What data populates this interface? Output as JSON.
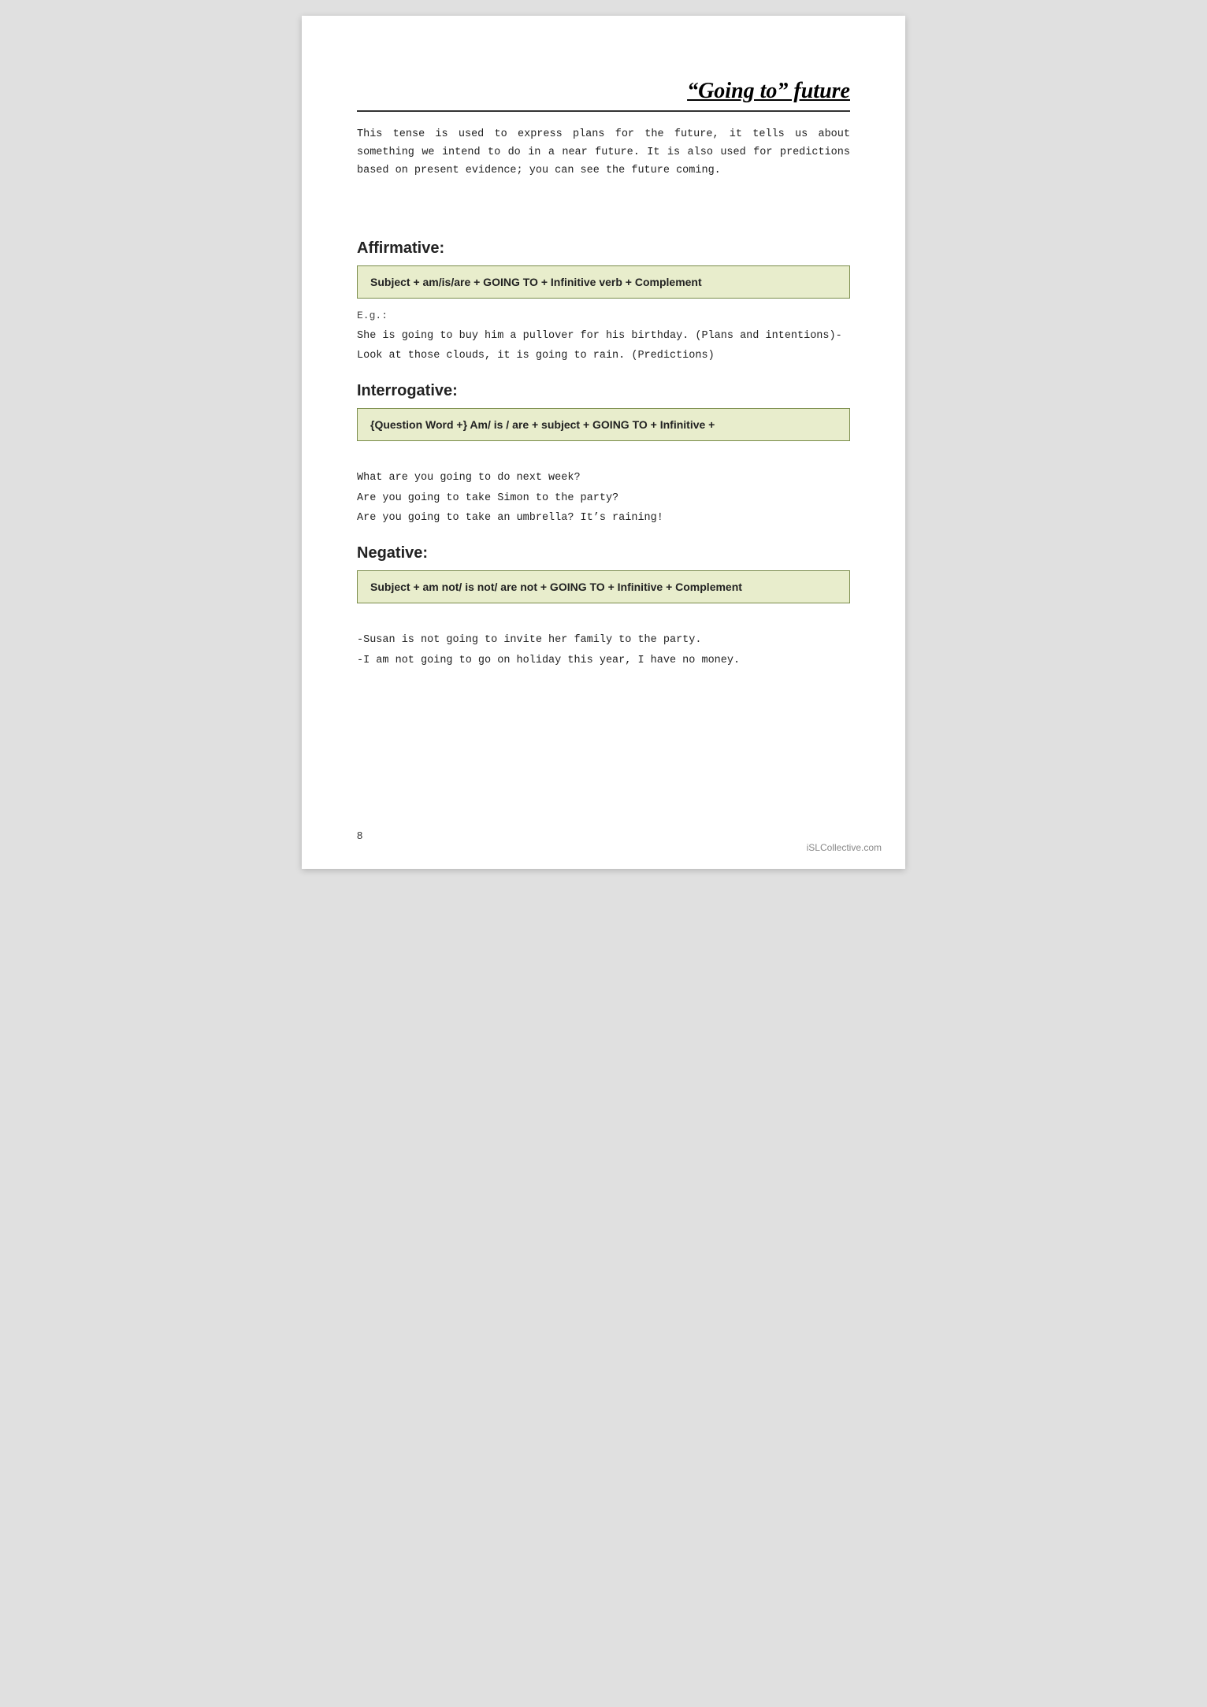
{
  "page": {
    "title": "“Going to” future",
    "intro": "This tense is used to express plans for the future, it tells us about something we intend to do in a near future. It is also used for predictions based on present evidence; you can see the future coming.",
    "affirmative": {
      "heading": "Affirmative:",
      "formula": "Subject   + am/is/are +  GOING TO  +  Infinitive verb   + Complement",
      "example_label": "E.g.:",
      "examples": [
        "She is going to buy him a pullover for his birthday. (Plans and intentions)-",
        "Look at those clouds, it is going to rain. (Predictions)"
      ]
    },
    "interrogative": {
      "heading": "Interrogative:",
      "formula": "{Question Word +} Am/ is / are  +  subject  + GOING TO +  Infinitive  +",
      "examples": [
        "What are you going to do next week?",
        "Are you going to take Simon to the party?",
        "Are you going to take an umbrella? It’s raining!"
      ]
    },
    "negative": {
      "heading": "Negative:",
      "formula": "Subject  + am not/ is not/ are not  + GOING TO  + Infinitive  + Complement",
      "examples": [
        "-Susan is not going to invite her family to the party.",
        "-I am not going to go on holiday this year, I have no money."
      ]
    },
    "page_number": "8",
    "watermark": "iSLCollective.com"
  }
}
